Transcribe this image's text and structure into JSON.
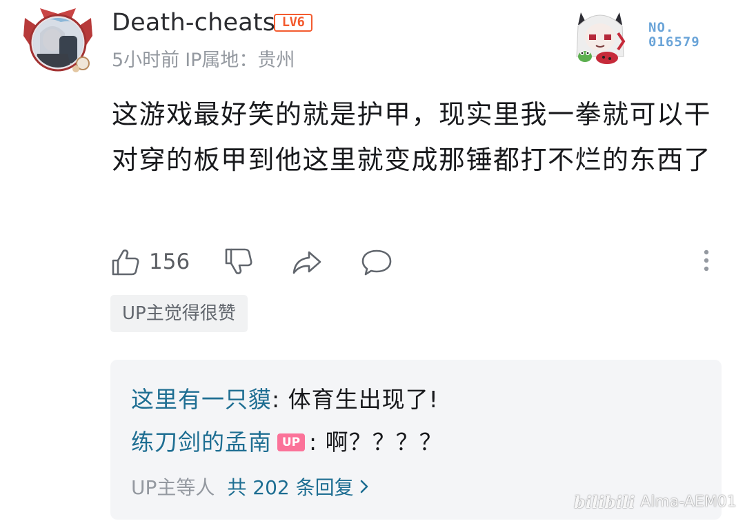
{
  "comment": {
    "username": "Death-cheats",
    "level_badge": "LV6",
    "time": "5小时前",
    "ip_location": "IP属地：贵州",
    "fan_card_number_label": "NO.",
    "fan_card_number": "016579",
    "content": "这游戏最好笑的就是护甲，现实里我一拳就可以干对穿的板甲到他这里就变成那锤都打不烂的东西了",
    "like_count": "156",
    "up_liked_tag": "UP主觉得很赞"
  },
  "replies": {
    "items": [
      {
        "name": "这里有一只貘",
        "text": ": 体育生出现了!",
        "is_up": false
      },
      {
        "name": "练刀剑的孟南",
        "badge": "UP",
        "text": ": 啊？？？？",
        "is_up": true
      }
    ],
    "summary_who": "UP主等人",
    "summary_total": "共 202 条回复"
  },
  "watermark": {
    "logo": "bilibili",
    "user": "Alma-AEM01"
  },
  "icons": {
    "like": "thumbs-up-icon",
    "dislike": "thumbs-down-icon",
    "share": "share-icon",
    "reply": "comment-icon",
    "more": "more-vertical-icon",
    "chevron": "chevron-right-icon"
  },
  "colors": {
    "level": "#f35b2f",
    "link": "#1e6e92",
    "up_badge": "#fb7299",
    "muted": "#9499a0",
    "reply_bg": "#f4f5f7"
  }
}
